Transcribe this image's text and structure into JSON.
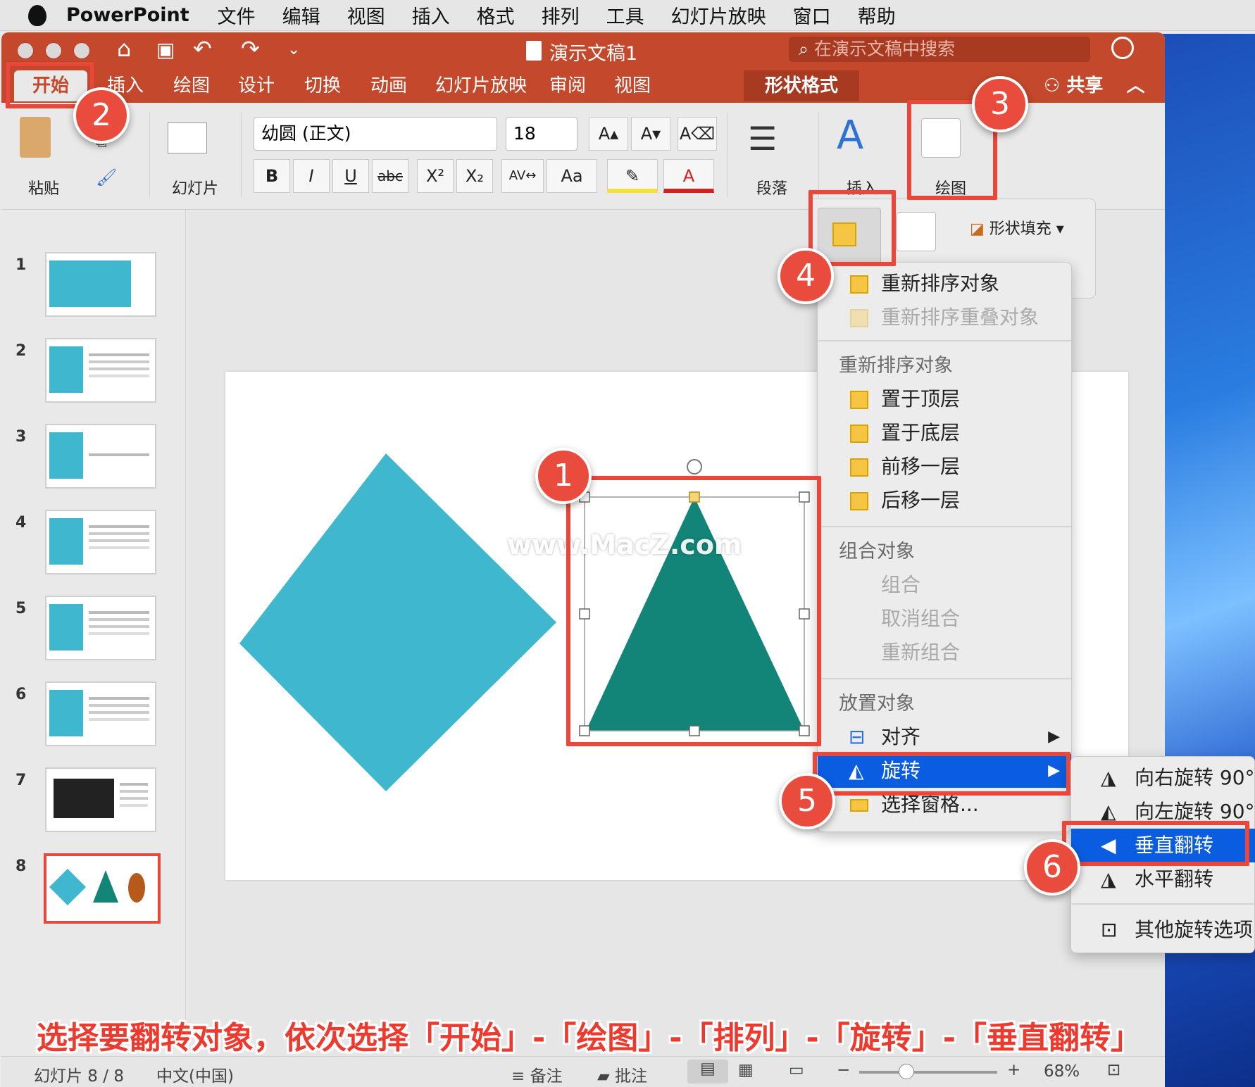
{
  "menubar": {
    "app": "PowerPoint",
    "items": [
      "文件",
      "编辑",
      "视图",
      "插入",
      "格式",
      "排列",
      "工具",
      "幻灯片放映",
      "窗口",
      "帮助"
    ]
  },
  "window": {
    "title": "演示文稿1",
    "search_placeholder": "在演示文稿中搜索"
  },
  "tabs": [
    "开始",
    "插入",
    "绘图",
    "设计",
    "切换",
    "动画",
    "幻灯片放映",
    "审阅",
    "视图",
    "形状格式"
  ],
  "share_label": "共享",
  "ribbon": {
    "paste": "粘贴",
    "slides": "幻灯片",
    "font_name": "幼圆 (正文)",
    "font_size": "18",
    "paragraph": "段落",
    "insert": "插入",
    "drawing": "绘图",
    "format_buttons": [
      "B",
      "I",
      "U",
      "abc",
      "X²",
      "X₂"
    ],
    "shape_fill": "形状填充"
  },
  "thumbnails": [
    "1",
    "2",
    "3",
    "4",
    "5",
    "6",
    "7",
    "8"
  ],
  "arrange_menu": {
    "reorder_objects": "重新排序对象",
    "reorder_overlap": "重新排序重叠对象",
    "section_reorder": "重新排序对象",
    "bring_front": "置于顶层",
    "send_back": "置于底层",
    "bring_forward": "前移一层",
    "send_backward": "后移一层",
    "section_group": "组合对象",
    "group": "组合",
    "ungroup": "取消组合",
    "regroup": "重新组合",
    "section_position": "放置对象",
    "align": "对齐",
    "rotate": "旋转",
    "selection_pane": "选择窗格..."
  },
  "rotate_menu": {
    "rotate_right": "向右旋转 90°",
    "rotate_left": "向左旋转 90°",
    "flip_vertical": "垂直翻转",
    "flip_horizontal": "水平翻转",
    "more": "其他旋转选项"
  },
  "badges": [
    "1",
    "2",
    "3",
    "4",
    "5",
    "6"
  ],
  "watermark": "www.MacZ.com",
  "caption": "选择要翻转对象，依次选择「开始」-「绘图」-「排列」-「旋转」-「垂直翻转」",
  "status": {
    "slide": "幻灯片 8 / 8",
    "lang": "中文(中国)",
    "notes": "备注",
    "comments": "批注",
    "zoom": "68%"
  },
  "colors": {
    "title_bar": "#c4482b",
    "accent_red": "#e8473b",
    "menu_highlight": "#0a5de0",
    "diamond": "#3fb8cf",
    "triangle": "#138578",
    "oval": "#b65a1c"
  }
}
